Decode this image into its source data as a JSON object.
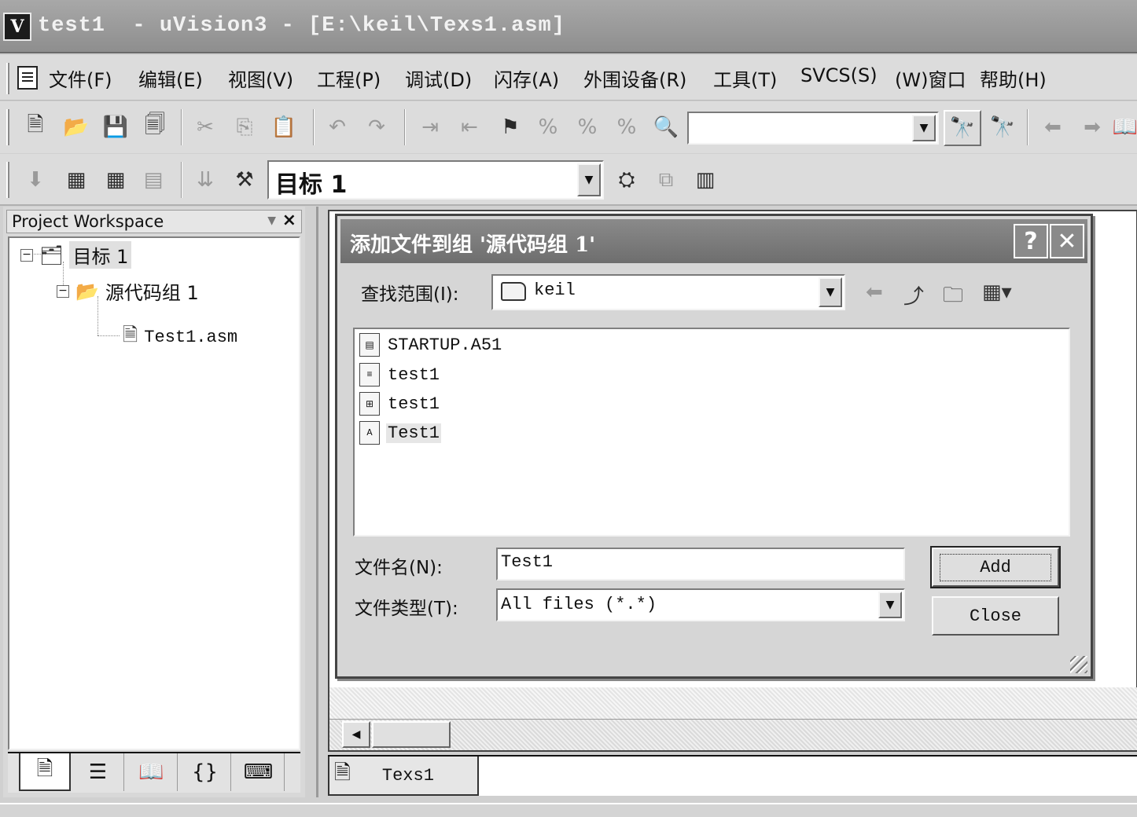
{
  "window": {
    "logo": "V",
    "title": "test1  - uVision3 - [E:\\keil\\Texs1.asm]"
  },
  "menu": {
    "items": [
      "文件(F)",
      "编辑(E)",
      "视图(V)",
      "工程(P)",
      "调试(D)",
      "闪存(A)",
      "外围设备(R)",
      "工具(T)",
      "SVCS(S)",
      "(W)窗口",
      "帮助(H)"
    ]
  },
  "toolbar": {
    "find_combo_value": "",
    "target_combo_value": "目标 1"
  },
  "workspace": {
    "title": "Project Workspace",
    "close_glyph": "×",
    "tree": {
      "target": "目标 1",
      "group": "源代码组 1",
      "file": "Test1.asm"
    }
  },
  "editor": {
    "tab_label": "Texs1"
  },
  "dialog": {
    "title": "添加文件到组 '源代码组 1'",
    "help_glyph": "?",
    "close_glyph": "✕",
    "look_in_label": "查找范围(I):",
    "look_in_value": "keil",
    "files": [
      {
        "name": "STARTUP.A51",
        "icon": "a51-file-icon",
        "selected": false
      },
      {
        "name": "test1",
        "icon": "text-file-icon",
        "selected": false
      },
      {
        "name": "test1",
        "icon": "uvproj-file-icon",
        "selected": false
      },
      {
        "name": "Test1",
        "icon": "asm-file-icon",
        "selected": true
      }
    ],
    "filename_label": "文件名(N):",
    "filename_value": "Test1",
    "filetype_label": "文件类型(T):",
    "filetype_value": "All files (*.*)",
    "add_label": "Add",
    "close_label": "Close"
  }
}
